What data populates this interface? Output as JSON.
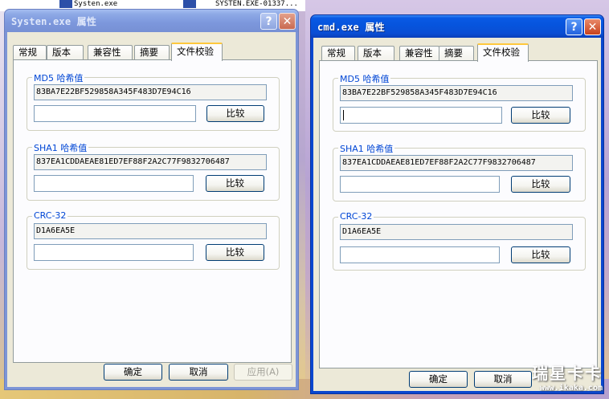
{
  "desktop": {
    "items": [
      "Systen.exe",
      "SYSTEN.EXE-01337..."
    ],
    "watermark_big": "瑞星卡卡",
    "watermark_url": "www.ikaka.com"
  },
  "window_left": {
    "title": "Systen.exe 属性",
    "help": "?",
    "close": "✕",
    "tabs": [
      "常规",
      "版本",
      "兼容性",
      "摘要",
      "文件校验"
    ],
    "md5_label": "MD5 哈希值",
    "md5_value": "83BA7E22BF529858A345F483D7E94C16",
    "md5_input": "",
    "sha1_label": "SHA1 哈希值",
    "sha1_value": "837EA1CDDAEAE81ED7EF88F2A2C77F9832706487",
    "sha1_input": "",
    "crc_label": "CRC-32",
    "crc_value": "D1A6EA5E",
    "crc_input": "",
    "compare": "比较",
    "ok": "确定",
    "cancel": "取消",
    "apply": "应用(A)"
  },
  "window_right": {
    "title": "cmd.exe 属性",
    "help": "?",
    "close": "✕",
    "tabs": [
      "常规",
      "版本",
      "兼容性",
      "摘要",
      "文件校验"
    ],
    "md5_label": "MD5 哈希值",
    "md5_value": "83BA7E22BF529858A345F483D7E94C16",
    "md5_input": "",
    "sha1_label": "SHA1 哈希值",
    "sha1_value": "837EA1CDDAEAE81ED7EF88F2A2C77F9832706487",
    "sha1_input": "",
    "crc_label": "CRC-32",
    "crc_value": "D1A6EA5E",
    "crc_input": "",
    "compare": "比较",
    "ok": "确定",
    "cancel": "取消"
  },
  "colors": {
    "titlebar_active": "#0a5ae4",
    "titlebar_inactive": "#7d95d6",
    "group_label": "#0046d5",
    "dialog_face": "#ece9d8",
    "active_tab_highlight": "#ffc83c"
  }
}
